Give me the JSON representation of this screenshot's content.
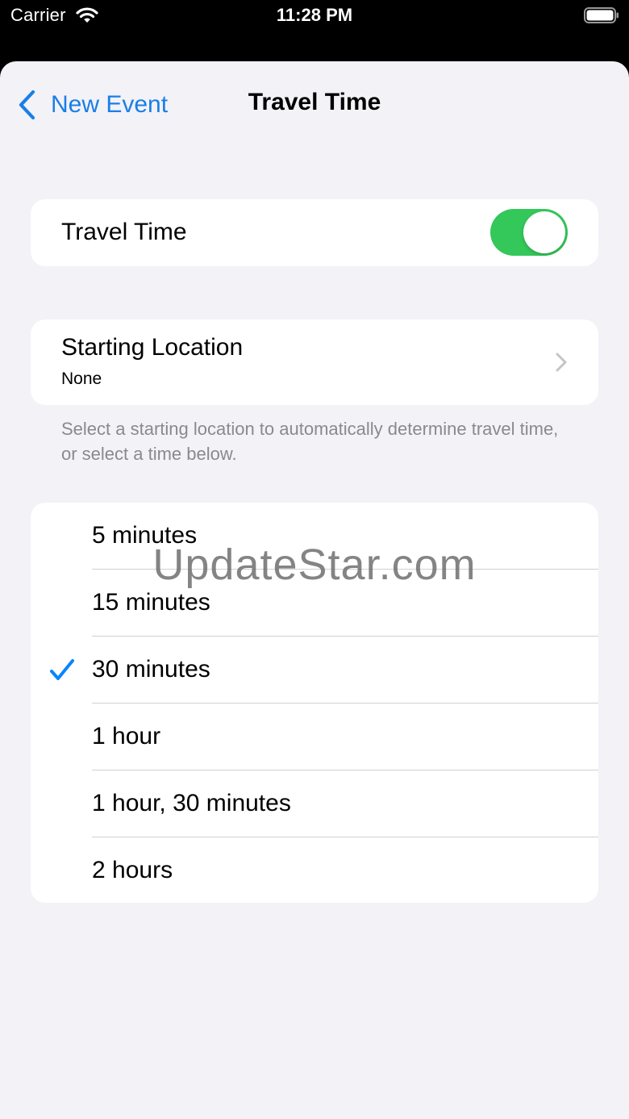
{
  "status_bar": {
    "carrier": "Carrier",
    "time": "11:28 PM"
  },
  "nav": {
    "back_label": "New Event",
    "title": "Travel Time"
  },
  "travel_time_toggle": {
    "label": "Travel Time",
    "on": true,
    "on_color": "#34c759"
  },
  "starting_location": {
    "label": "Starting Location",
    "value": "None"
  },
  "footer_note": "Select a starting location to automatically determine travel time, or select a time below.",
  "time_options": [
    {
      "label": "5 minutes",
      "selected": false
    },
    {
      "label": "15 minutes",
      "selected": false
    },
    {
      "label": "30 minutes",
      "selected": true
    },
    {
      "label": "1 hour",
      "selected": false
    },
    {
      "label": "1 hour, 30 minutes",
      "selected": false
    },
    {
      "label": "2 hours",
      "selected": false
    }
  ],
  "watermark": "UpdateStar.com",
  "colors": {
    "accent": "#0a84ff",
    "background": "#f2f2f7",
    "secondary_text": "#8a8a8e"
  },
  "icons": {
    "back": "chevron-left-icon",
    "disclosure": "chevron-right-icon",
    "selected": "checkmark-icon",
    "wifi": "wifi-icon",
    "battery": "battery-icon"
  }
}
